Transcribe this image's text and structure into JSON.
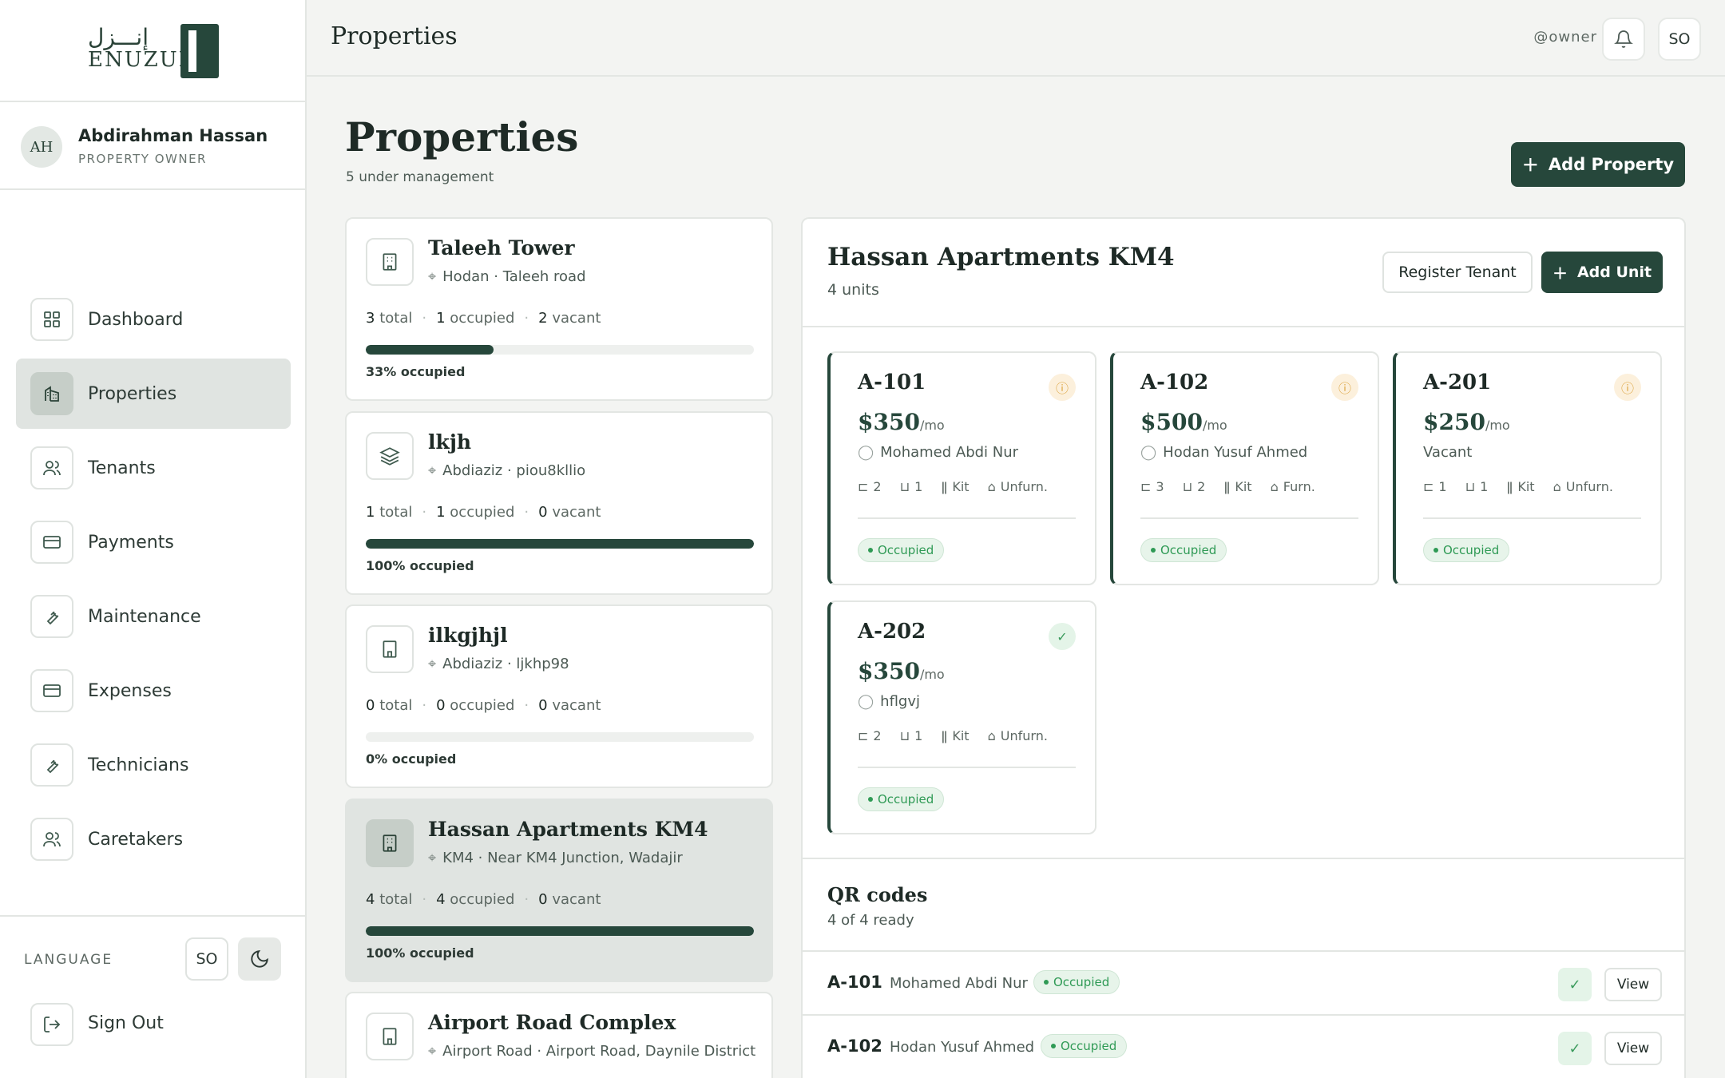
{
  "brand": {
    "name_ar": "إنـــزل",
    "name_en": "ENUZUL"
  },
  "profile": {
    "initials": "AH",
    "name": "Abdirahman Hassan",
    "role": "PROPERTY OWNER"
  },
  "nav": [
    {
      "label": "Dashboard",
      "icon": "grid-icon",
      "active": false
    },
    {
      "label": "Properties",
      "icon": "building-icon",
      "active": true
    },
    {
      "label": "Tenants",
      "icon": "users-icon",
      "active": false
    },
    {
      "label": "Payments",
      "icon": "card-icon",
      "active": false
    },
    {
      "label": "Maintenance",
      "icon": "wrench-icon",
      "active": false
    },
    {
      "label": "Expenses",
      "icon": "card-icon",
      "active": false
    },
    {
      "label": "Technicians",
      "icon": "wrench-icon",
      "active": false
    },
    {
      "label": "Caretakers",
      "icon": "users-icon",
      "active": false
    }
  ],
  "language": {
    "label": "LANGUAGE",
    "current": "SO",
    "sign_out": "Sign Out"
  },
  "topbar": {
    "title": "Properties",
    "user": "@owner",
    "lang": "SO"
  },
  "header": {
    "title": "Properties",
    "subtitle": "5 under management",
    "add_button": "Add Property"
  },
  "properties": [
    {
      "name": "Taleeh Tower",
      "location": "Hodan · Taleeh road",
      "total": "3",
      "occupied": "1",
      "vacant": "2",
      "occupancy": 0.33,
      "pct_label": "33% occupied",
      "selected": false
    },
    {
      "name": "lkjh",
      "location": "Abdiaziz · piou8kllio",
      "total": "1",
      "occupied": "1",
      "vacant": "0",
      "occupancy": 1.0,
      "pct_label": "100% occupied",
      "selected": false
    },
    {
      "name": "ilkgjhjl",
      "location": "Abdiaziz · ljkhp98",
      "total": "0",
      "occupied": "0",
      "vacant": "0",
      "occupancy": 0,
      "pct_label": "0% occupied",
      "selected": false
    },
    {
      "name": "Hassan Apartments KM4",
      "location": "KM4 · Near KM4 Junction, Wadajir",
      "total": "4",
      "occupied": "4",
      "vacant": "0",
      "occupancy": 1.0,
      "pct_label": "100% occupied",
      "selected": true
    },
    {
      "name": "Airport Road Complex",
      "location": "Airport Road · Airport Road, Daynile District"
    }
  ],
  "stat_words": {
    "total": "total",
    "occupied": "occupied",
    "vacant": "vacant"
  },
  "detail": {
    "title": "Hassan Apartments KM4",
    "subtitle": "4 units",
    "register_button": "Register Tenant",
    "add_unit_button": "Add Unit",
    "per_month": "/mo",
    "units": [
      {
        "code": "A-101",
        "rent": "$350",
        "tenant": "Mohamed Abdi Nur",
        "has_tenant": true,
        "beds": "2",
        "baths": "1",
        "kitchen": "Kit",
        "furnish": "Unfurn.",
        "badge": "Occupied",
        "status": "warn"
      },
      {
        "code": "A-102",
        "rent": "$500",
        "tenant": "Hodan Yusuf Ahmed",
        "has_tenant": true,
        "beds": "3",
        "baths": "2",
        "kitchen": "Kit",
        "furnish": "Furn.",
        "badge": "Occupied",
        "status": "warn"
      },
      {
        "code": "A-201",
        "rent": "$250",
        "tenant": "Vacant",
        "has_tenant": false,
        "beds": "1",
        "baths": "1",
        "kitchen": "Kit",
        "furnish": "Unfurn.",
        "badge": "Occupied",
        "status": "warn"
      },
      {
        "code": "A-202",
        "rent": "$350",
        "tenant": "hflgvj",
        "has_tenant": true,
        "beds": "2",
        "baths": "1",
        "kitchen": "Kit",
        "furnish": "Unfurn.",
        "badge": "Occupied",
        "status": "ok"
      }
    ]
  },
  "qr": {
    "title": "QR codes",
    "subtitle": "4 of 4 ready",
    "view_label": "View",
    "rows": [
      {
        "code": "A-101",
        "tenant": "Mohamed Abdi Nur",
        "badge": "Occupied"
      },
      {
        "code": "A-102",
        "tenant": "Hodan Yusuf Ahmed",
        "badge": "Occupied"
      }
    ]
  }
}
